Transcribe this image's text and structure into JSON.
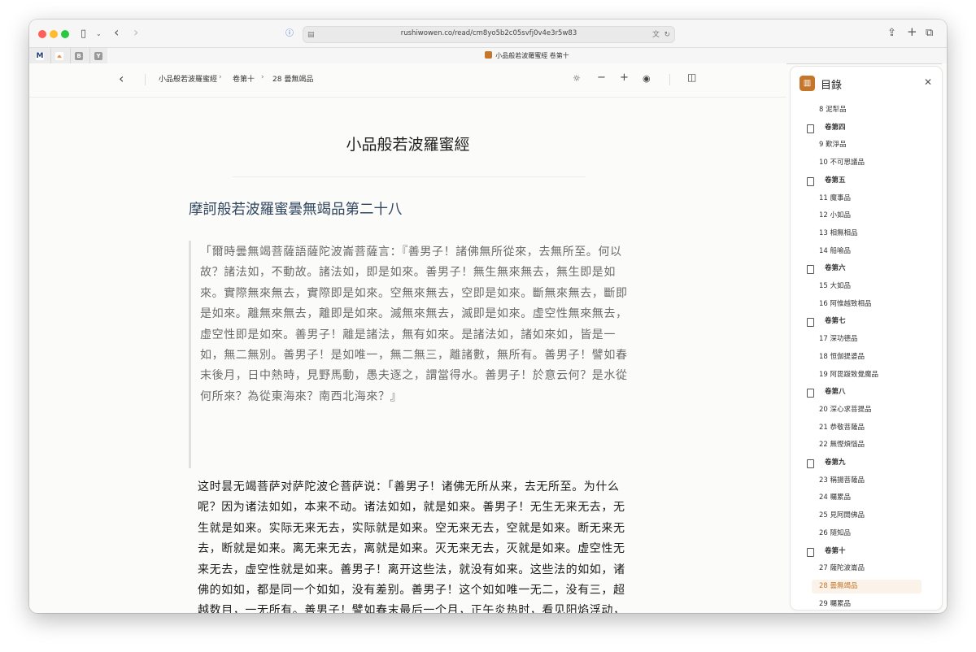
{
  "browser": {
    "url": "rushiwowen.co/read/cm8yo5b2c05svfj0v4e3r5w83",
    "tab_title": "小品般若波羅蜜經 卷第十",
    "pinned_tabs": [
      {
        "letter": "M",
        "color": "#1f3d7a"
      },
      {
        "letter": "⩕",
        "color": "#e07a2a"
      },
      {
        "letter": "B",
        "color": "#9a9a9a"
      },
      {
        "letter": "Y",
        "color": "#9a9a9a"
      }
    ]
  },
  "reader": {
    "breadcrumb": [
      "小品般若波羅蜜經",
      "卷第十",
      "28 曇無竭品"
    ],
    "book_title": "小品般若波羅蜜經",
    "chapter_title": "摩訶般若波羅蜜曇無竭品第二十八",
    "quote": "「爾時曇無竭菩薩語薩陀波崙菩薩言：『善男子！諸佛無所從來，去無所至。何以故？諸法如，不動故。諸法如，即是如來。善男子！無生無來無去，無生即是如來。實際無來無去，實際即是如來。空無來無去，空即是如來。斷無來無去，斷即是如來。離無來無去，離即是如來。滅無來無去，滅即是如來。虛空性無來無去，虛空性即是如來。善男子！離是諸法，無有如來。是諸法如，諸如來如，皆是一如，無二無別。善男子！是如唯一，無二無三，離諸數，無所有。善男子！譬如春末後月，日中熱時，見野馬動，愚夫逐之，謂當得水。善男子！於意云何？是水從何所來？為從東海來？南西北海來？』",
    "translation": "这时昙无竭菩萨对萨陀波仑菩萨说：「善男子！诸佛无所从来，去无所至。为什么呢？因为诸法如如，本来不动。诸法如如，就是如来。善男子！无生无来无去，无生就是如来。实际无来无去，实际就是如来。空无来无去，空就是如来。断无来无去，断就是如来。离无来无去，离就是如来。灭无来无去，灭就是如来。虚空性无来无去，虚空性就是如来。善男子！离开这些法，就没有如来。这些法的如如，诸佛的如如，都是同一个如如，没有差别。善男子！这个如如唯一无二，没有三，超越数目，一无所有。善男子！譬如春末最后一个月，正午炎热时，看见阳焰浮动，愚人追逐它，以为能得到水。善男子！你认为如何？这水是从哪里来的？是从东海来的？还是从南西"
  },
  "toc": {
    "title": "目錄",
    "entries": [
      {
        "label": "8 泥犁品",
        "kind": "item"
      },
      {
        "label": "卷第四",
        "kind": "vol"
      },
      {
        "label": "9 歎淨品",
        "kind": "item"
      },
      {
        "label": "10 不可思議品",
        "kind": "item"
      },
      {
        "label": "卷第五",
        "kind": "vol"
      },
      {
        "label": "11 魔事品",
        "kind": "item"
      },
      {
        "label": "12 小如品",
        "kind": "item"
      },
      {
        "label": "13 相無相品",
        "kind": "item"
      },
      {
        "label": "14 船喻品",
        "kind": "item"
      },
      {
        "label": "卷第六",
        "kind": "vol"
      },
      {
        "label": "15 大如品",
        "kind": "item"
      },
      {
        "label": "16 阿惟越致相品",
        "kind": "item"
      },
      {
        "label": "卷第七",
        "kind": "vol"
      },
      {
        "label": "17 深功德品",
        "kind": "item"
      },
      {
        "label": "18 恒伽提婆品",
        "kind": "item"
      },
      {
        "label": "19 阿毘跋致覺魔品",
        "kind": "item"
      },
      {
        "label": "卷第八",
        "kind": "vol"
      },
      {
        "label": "20 深心求菩提品",
        "kind": "item"
      },
      {
        "label": "21 恭敬菩薩品",
        "kind": "item"
      },
      {
        "label": "22 無慳煩惱品",
        "kind": "item"
      },
      {
        "label": "卷第九",
        "kind": "vol"
      },
      {
        "label": "23 稱揚菩薩品",
        "kind": "item"
      },
      {
        "label": "24 囑累品",
        "kind": "item"
      },
      {
        "label": "25 見阿閦佛品",
        "kind": "item"
      },
      {
        "label": "26 隨知品",
        "kind": "item"
      },
      {
        "label": "卷第十",
        "kind": "vol"
      },
      {
        "label": "27 薩陀波崙品",
        "kind": "item"
      },
      {
        "label": "28 曇無竭品",
        "kind": "item",
        "active": true
      },
      {
        "label": "29 囑累品",
        "kind": "item"
      }
    ]
  },
  "colors": {
    "accent": "#c5762a",
    "chapter": "#30465e"
  }
}
